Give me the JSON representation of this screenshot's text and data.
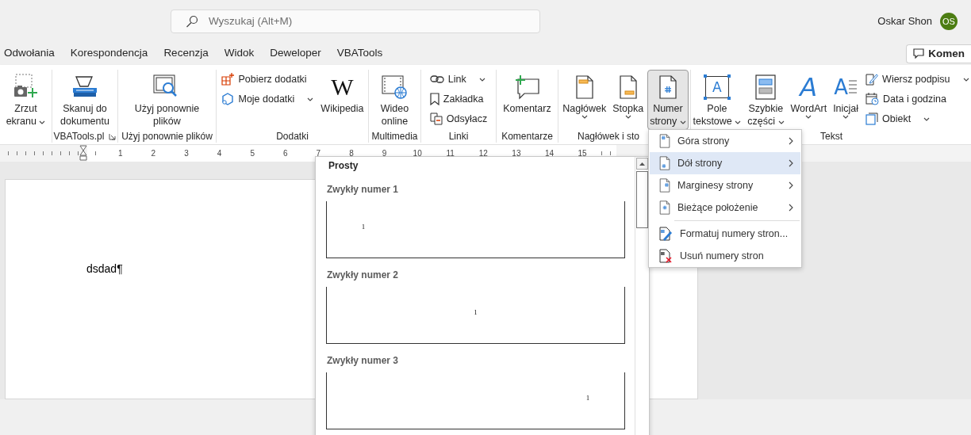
{
  "search": {
    "placeholder": "Wyszukaj (Alt+M)"
  },
  "user": {
    "name": "Oskar Shon",
    "initials": "OS"
  },
  "tabs": [
    {
      "label": "Odwołania"
    },
    {
      "label": "Korespondencja"
    },
    {
      "label": "Recenzja"
    },
    {
      "label": "Widok"
    },
    {
      "label": "Deweloper"
    },
    {
      "label": "VBATools"
    }
  ],
  "comment_button": {
    "label": "Komen"
  },
  "ribbon": {
    "groups": [
      {
        "items": [
          {
            "kind": "large",
            "label": "Zrzut\nekranu",
            "dropdown": true,
            "pressed": false
          }
        ]
      },
      {
        "label": "VBATools.pl",
        "launcher": true,
        "items": [
          {
            "kind": "large",
            "label": "Skanuj do\ndokumentu",
            "pressed": false
          }
        ]
      },
      {
        "label": "Użyj ponownie plików",
        "items": [
          {
            "kind": "large",
            "label": "Użyj ponownie\nplików",
            "pressed": false
          }
        ]
      },
      {
        "label": "Dodatki",
        "items": [
          {
            "kind": "stack",
            "buttons": [
              {
                "label": "Pobierz dodatki"
              },
              {
                "label": "Moje dodatki",
                "dropdown": true
              }
            ]
          },
          {
            "kind": "large",
            "label": "Wikipedia",
            "glyph": "W",
            "pressed": false
          }
        ]
      },
      {
        "label": "Multimedia",
        "items": [
          {
            "kind": "large",
            "label": "Wideo\nonline",
            "pressed": false
          }
        ]
      },
      {
        "label": "Linki",
        "items": [
          {
            "kind": "stack",
            "buttons": [
              {
                "label": "Link",
                "dropdown": true
              },
              {
                "label": "Zakładka"
              },
              {
                "label": "Odsyłacz"
              }
            ]
          }
        ]
      },
      {
        "label": "Komentarze",
        "items": [
          {
            "kind": "large",
            "label": "Komentarz",
            "pressed": false
          }
        ]
      },
      {
        "label": "Nagłówek i sto",
        "items": [
          {
            "kind": "large",
            "label": "Nagłówek",
            "dropdown": true,
            "pressed": false
          },
          {
            "kind": "large",
            "label": "Stopka",
            "dropdown": true,
            "pressed": false
          },
          {
            "kind": "large",
            "label": "Numer\nstrony",
            "dropdown": true,
            "pressed": true
          }
        ]
      },
      {
        "label": "Tekst",
        "items": [
          {
            "kind": "large",
            "label": "Pole\ntekstowe",
            "dropdown": true,
            "glyph": "A",
            "pressed": false
          },
          {
            "kind": "large",
            "label": "Szybkie\nczęści",
            "dropdown": true,
            "pressed": false
          },
          {
            "kind": "large",
            "label": "WordArt",
            "dropdown": true,
            "glyph": "A",
            "pressed": false
          },
          {
            "kind": "large",
            "label": "Inicjał",
            "dropdown": true,
            "glyph": "A",
            "pressed": false
          },
          {
            "kind": "stack",
            "buttons": [
              {
                "label": "Wiersz podpisu",
                "dropdown": true
              },
              {
                "label": "Data i godzina"
              },
              {
                "label": "Obiekt",
                "dropdown": true
              }
            ]
          }
        ]
      }
    ]
  },
  "ruler": {
    "numbers": [
      "1",
      "2",
      "3",
      "4",
      "5",
      "6",
      "7",
      "8",
      "9",
      "10",
      "11",
      "12",
      "13",
      "14",
      "15"
    ]
  },
  "document": {
    "text": "dsdad¶"
  },
  "gallery": {
    "heading": "Prosty",
    "entries": [
      {
        "label": "Zwykły numer 1",
        "number": "1",
        "kind": "left"
      },
      {
        "label": "Zwykły numer 2",
        "number": "1",
        "kind": "center"
      },
      {
        "label": "Zwykły numer 3",
        "number": "1",
        "kind": "right"
      }
    ]
  },
  "page_number_menu": {
    "groups": [
      [
        {
          "label": "Góra strony",
          "submenu": true,
          "selected": false
        },
        {
          "label": "Dół strony",
          "submenu": true,
          "selected": true
        },
        {
          "label": "Marginesy strony",
          "submenu": true,
          "selected": false
        },
        {
          "label": "Bieżące położenie",
          "submenu": true,
          "selected": false
        }
      ],
      [
        {
          "label": "Formatuj numery stron...",
          "submenu": false,
          "selected": false
        },
        {
          "label": "Usuń numery stron",
          "submenu": false,
          "selected": false
        }
      ]
    ]
  }
}
